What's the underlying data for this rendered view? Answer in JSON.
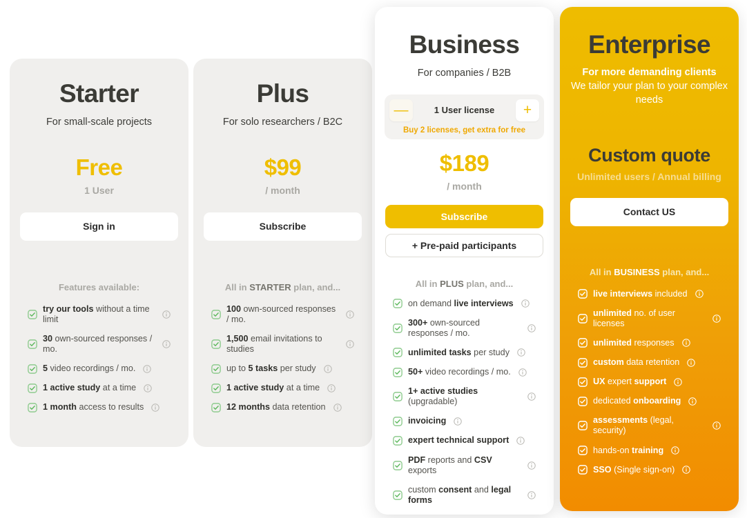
{
  "plans": [
    {
      "id": "starter",
      "name": "Starter",
      "subtitle": "For small-scale projects",
      "price": "Free",
      "price_unit": "1 User",
      "cta_label": "Sign in",
      "features_heading_plain": "Features available:",
      "features_heading_prefix": "",
      "features_heading_bold": "",
      "features_heading_suffix": "",
      "features": [
        {
          "bold": "try our tools",
          "rest": " without a time limit",
          "lead": "",
          "info": "info-icon"
        },
        {
          "bold": "30",
          "rest": " own-sourced responses / mo.",
          "lead": "",
          "info": "info-icon"
        },
        {
          "bold": "5",
          "rest": " video recordings / mo.",
          "lead": "",
          "info": "info-icon"
        },
        {
          "bold": "1 active study",
          "rest": " at a time",
          "lead": "",
          "info": "info-icon"
        },
        {
          "bold": "1 month",
          "rest": " access to results",
          "lead": "",
          "info": "info-icon"
        }
      ]
    },
    {
      "id": "plus",
      "name": "Plus",
      "subtitle": "For solo researchers / B2C",
      "price": "$99",
      "price_unit": "/ month",
      "cta_label": "Subscribe",
      "features_heading_plain": "",
      "features_heading_prefix": "All in ",
      "features_heading_bold": "STARTER",
      "features_heading_suffix": " plan, and...",
      "features": [
        {
          "bold": "100",
          "rest": " own-sourced responses / mo.",
          "lead": "",
          "info": "info-icon"
        },
        {
          "bold": "1,500",
          "rest": " email invitations to studies",
          "lead": "",
          "info": "info-icon"
        },
        {
          "bold": "5 tasks",
          "rest": " per study",
          "lead": "up to ",
          "info": "info-icon"
        },
        {
          "bold": "1 active study",
          "rest": " at a time",
          "lead": "",
          "info": "info-icon"
        },
        {
          "bold": "12 months",
          "rest": " data retention",
          "lead": "",
          "info": "info-icon"
        }
      ]
    },
    {
      "id": "business",
      "name": "Business",
      "subtitle": "For companies / B2B",
      "license_label": "1 User license",
      "license_note": "Buy 2 licenses, get extra for free",
      "decrement_label": "—",
      "increment_label": "+",
      "price": "$189",
      "price_unit": "/ month",
      "cta_label": "Subscribe",
      "secondary_cta_label": "+ Pre-paid participants",
      "features_heading_plain": "",
      "features_heading_prefix": "All in ",
      "features_heading_bold": "PLUS",
      "features_heading_suffix": " plan, and...",
      "features": [
        {
          "bold": "live interviews",
          "rest": "",
          "lead": "on demand ",
          "info": "info-icon"
        },
        {
          "bold": "300+",
          "rest": " own-sourced responses / mo.",
          "lead": "",
          "info": "info-icon"
        },
        {
          "bold": "unlimited tasks",
          "rest": " per study",
          "lead": "",
          "info": "info-icon"
        },
        {
          "bold": "50+",
          "rest": " video recordings / mo.",
          "lead": "",
          "info": "info-icon"
        },
        {
          "bold": "1+ active studies",
          "rest": " (upgradable)",
          "lead": "",
          "info": "info-icon"
        },
        {
          "bold": "invoicing",
          "rest": "",
          "lead": "",
          "info": "info-icon"
        },
        {
          "bold": "expert technical support",
          "rest": "",
          "lead": "",
          "info": "info-icon"
        },
        {
          "bold": "PDF",
          "rest": " reports and ",
          "lead": "",
          "bold2": "CSV",
          "rest2": " exports",
          "info": "info-icon"
        },
        {
          "bold": "consent",
          "rest": " and ",
          "lead": "custom ",
          "bold2": "legal forms",
          "rest2": "",
          "info": "info-icon"
        }
      ]
    },
    {
      "id": "enterprise",
      "name": "Enterprise",
      "subtitle_strong": "For more demanding clients",
      "subtitle_light": "We tailor your plan to your complex needs",
      "price": "Custom quote",
      "price_unit": "Unlimited users / Annual billing",
      "cta_label": "Contact US",
      "features_heading_plain": "",
      "features_heading_prefix": "All in ",
      "features_heading_bold": "BUSINESS",
      "features_heading_suffix": " plan, and...",
      "features": [
        {
          "bold": "live interviews",
          "rest": " included",
          "lead": "",
          "info": "info-icon"
        },
        {
          "bold": "unlimited",
          "rest": " no. of user licenses",
          "lead": "",
          "info": "info-icon"
        },
        {
          "bold": "unlimited",
          "rest": " responses",
          "lead": "",
          "info": "info-icon"
        },
        {
          "bold": "custom",
          "rest": " data retention",
          "lead": "",
          "info": "info-icon"
        },
        {
          "bold": "UX",
          "rest": " expert ",
          "lead": "",
          "bold2": "support",
          "rest2": "",
          "info": "info-icon"
        },
        {
          "bold": "onboarding",
          "rest": "",
          "lead": "dedicated ",
          "info": "info-icon"
        },
        {
          "bold": "assessments",
          "rest": " (legal, security)",
          "lead": "",
          "info": "info-icon"
        },
        {
          "bold": "training",
          "rest": "",
          "lead": "hands-on ",
          "info": "info-icon"
        },
        {
          "bold": "SSO",
          "rest": " (Single sign-on)",
          "lead": "",
          "info": "info-icon"
        }
      ]
    }
  ],
  "colors": {
    "accent_yellow": "#efbe00",
    "accent_orange": "#f28c00",
    "card_gray": "#f0efed",
    "text_dark": "#3b3b36",
    "text_muted": "#a9a8a3",
    "check_green": "#6cbf6c"
  }
}
